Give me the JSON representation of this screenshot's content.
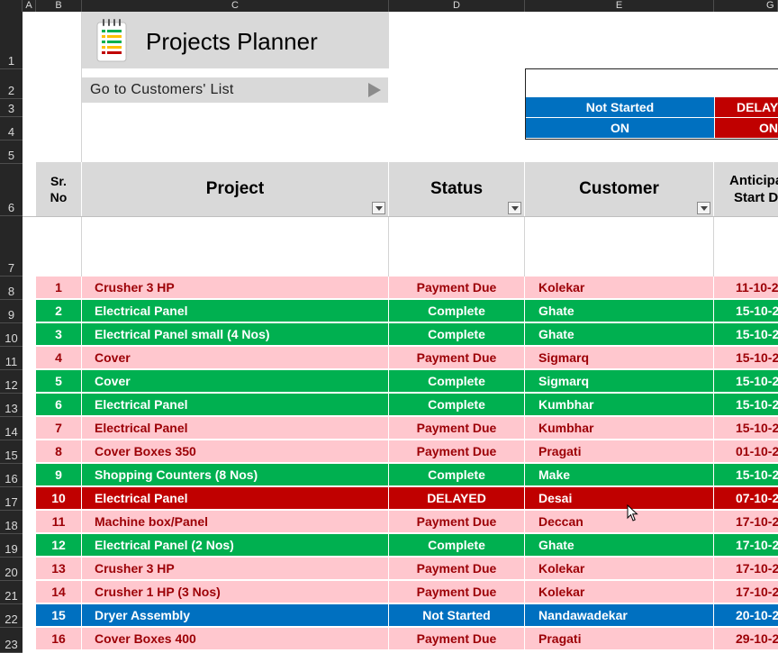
{
  "column_headers": [
    "A",
    "B",
    "C",
    "D",
    "E",
    "G"
  ],
  "row_numbers": [
    "1",
    "2",
    "3",
    "4",
    "5",
    "6",
    "7",
    "8",
    "9",
    "10",
    "11",
    "12",
    "13",
    "14",
    "15",
    "16",
    "17",
    "18",
    "19",
    "20",
    "21",
    "22",
    "23"
  ],
  "title": "Projects Planner",
  "goto_label": "Go to Customers' List",
  "legend": {
    "not_started": "Not Started",
    "delayed": "DELAYE",
    "on_blue": "ON",
    "on_red": "ON"
  },
  "table_headers": {
    "sr_no": "Sr.\nNo",
    "project": "Project",
    "status": "Status",
    "customer": "Customer",
    "anticipated_start": "Anticipa\nStart D"
  },
  "colors": {
    "payment_due_bg": "#ffc7ce",
    "payment_due_fg": "#9c0006",
    "complete_bg": "#00b050",
    "delayed_bg": "#c00000",
    "not_started_bg": "#0070c0",
    "white_fg": "#ffffff"
  },
  "rows": [
    {
      "sr": "1",
      "project": "Crusher 3 HP",
      "status": "Payment Due",
      "customer": "Kolekar",
      "date": "11-10-2"
    },
    {
      "sr": "2",
      "project": "Electrical Panel",
      "status": "Complete",
      "customer": "Ghate",
      "date": "15-10-2"
    },
    {
      "sr": "3",
      "project": "Electrical Panel small (4 Nos)",
      "status": "Complete",
      "customer": "Ghate",
      "date": "15-10-2"
    },
    {
      "sr": "4",
      "project": "Cover",
      "status": "Payment Due",
      "customer": "Sigmarq",
      "date": "15-10-2"
    },
    {
      "sr": "5",
      "project": "Cover",
      "status": "Complete",
      "customer": "Sigmarq",
      "date": "15-10-2"
    },
    {
      "sr": "6",
      "project": "Electrical Panel",
      "status": "Complete",
      "customer": "Kumbhar",
      "date": "15-10-2"
    },
    {
      "sr": "7",
      "project": "Electrical Panel",
      "status": "Payment Due",
      "customer": "Kumbhar",
      "date": "15-10-2"
    },
    {
      "sr": "8",
      "project": "Cover Boxes 350",
      "status": "Payment Due",
      "customer": "Pragati",
      "date": "01-10-2"
    },
    {
      "sr": "9",
      "project": "Shopping Counters (8 Nos)",
      "status": "Complete",
      "customer": "Make",
      "date": "15-10-2"
    },
    {
      "sr": "10",
      "project": "Electrical Panel",
      "status": "DELAYED",
      "customer": "Desai",
      "date": "07-10-2"
    },
    {
      "sr": "11",
      "project": "Machine box/Panel",
      "status": "Payment Due",
      "customer": "Deccan",
      "date": "17-10-2"
    },
    {
      "sr": "12",
      "project": "Electrical Panel (2 Nos)",
      "status": "Complete",
      "customer": "Ghate",
      "date": "17-10-2"
    },
    {
      "sr": "13",
      "project": "Crusher 3 HP",
      "status": "Payment Due",
      "customer": "Kolekar",
      "date": "17-10-2"
    },
    {
      "sr": "14",
      "project": "Crusher 1 HP (3 Nos)",
      "status": "Payment Due",
      "customer": "Kolekar",
      "date": "17-10-2"
    },
    {
      "sr": "15",
      "project": "Dryer Assembly",
      "status": "Not Started",
      "customer": "Nandawadekar",
      "date": "20-10-2"
    },
    {
      "sr": "16",
      "project": "Cover Boxes 400",
      "status": "Payment Due",
      "customer": "Pragati",
      "date": "29-10-2"
    }
  ]
}
